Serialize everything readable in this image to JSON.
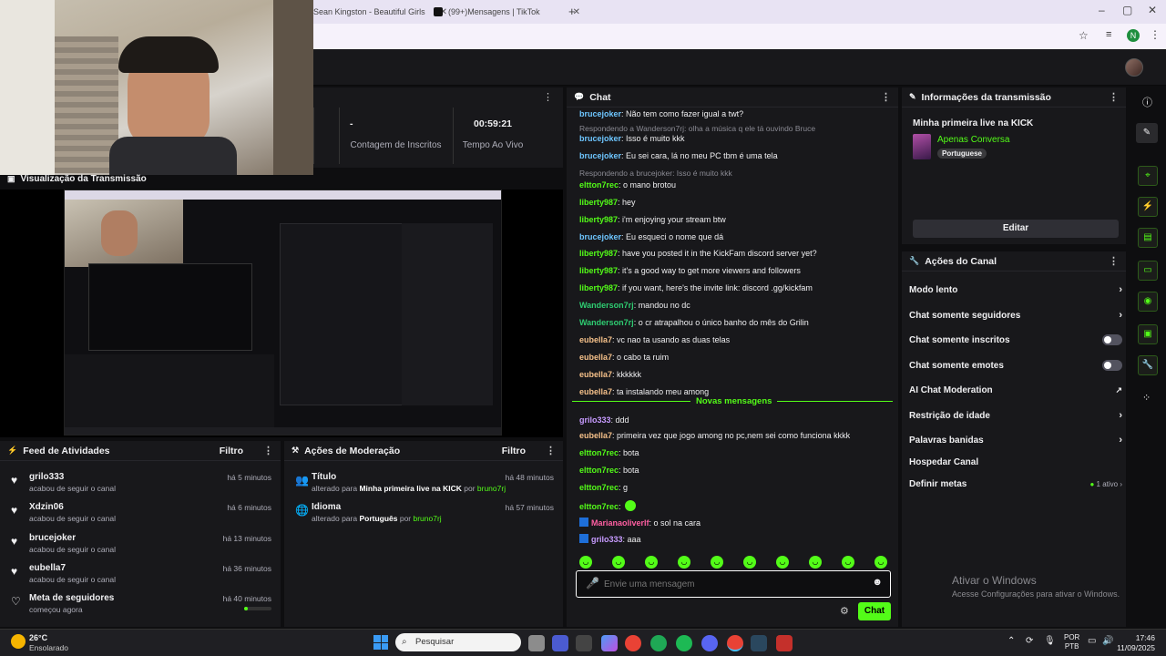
{
  "browser": {
    "tabs": [
      {
        "label": "Sean Kingston - Beautiful Girls"
      },
      {
        "label": "(99+)Mensagens | TikTok"
      }
    ],
    "new_tab": "+",
    "profile_initial": "N"
  },
  "stats": {
    "subs_value": "-",
    "subs_label": "Contagem de Inscritos",
    "time_value": "00:59:21",
    "time_label": "Tempo Ao Vivo"
  },
  "preview": {
    "title": "Visualização da Transmissão"
  },
  "activity": {
    "title": "Feed de Atividades",
    "filter": "Filtro",
    "items": [
      {
        "name": "grilo333",
        "desc": "acabou de seguir o canal",
        "time": "há 5 minutos"
      },
      {
        "name": "Xdzin06",
        "desc": "acabou de seguir o canal",
        "time": "há 6 minutos"
      },
      {
        "name": "brucejoker",
        "desc": "acabou de seguir o canal",
        "time": "há 13 minutos"
      },
      {
        "name": "eubella7",
        "desc": "acabou de seguir o canal",
        "time": "há 36 minutos"
      },
      {
        "name": "Meta de seguidores",
        "desc": "começou agora",
        "time": "há 40 minutos"
      }
    ]
  },
  "moderation": {
    "title": "Ações de Moderação",
    "filter": "Filtro",
    "items": [
      {
        "name": "Título",
        "pre": "alterado para ",
        "val": "Minha primeira live na KICK",
        "by": " por ",
        "user": "bruno7rj",
        "time": "há 48 minutos"
      },
      {
        "name": "Idioma",
        "pre": "alterado para ",
        "val": "Português",
        "by": " por ",
        "user": "bruno7rj",
        "time": "há 57 minutos"
      }
    ]
  },
  "chat": {
    "title": "Chat",
    "new_messages": "Novas mensagens",
    "placeholder": "Envie uma mensagem",
    "send": "Chat",
    "messages": [
      {
        "user": "brucejoker",
        "text": ": Não tem como fazer igual a twt?",
        "color": "#6ec6ff"
      },
      {
        "reply": "Respondendo a Wanderson7rj: olha a música q ele tá ouvindo Bruce"
      },
      {
        "user": "brucejoker",
        "text": ": Isso é muito kkk",
        "color": "#6ec6ff"
      },
      {
        "user": "brucejoker",
        "text": ": Eu sei cara, lá no meu PC tbm é uma tela",
        "color": "#6ec6ff"
      },
      {
        "reply": "Respondendo a brucejoker: Isso é muito kkk"
      },
      {
        "user": "eltton7rec",
        "text": ": o mano brotou",
        "color": "#53fc18"
      },
      {
        "user": "liberty987",
        "text": ": hey",
        "color": "#53fc18"
      },
      {
        "user": "liberty987",
        "text": ": i'm enjoying your stream btw",
        "color": "#53fc18"
      },
      {
        "user": "brucejoker",
        "text": ": Eu esqueci o nome que dá",
        "color": "#6ec6ff"
      },
      {
        "user": "liberty987",
        "text": ": have you posted it in the KickFam discord server yet?",
        "color": "#53fc18"
      },
      {
        "user": "liberty987",
        "text": ": it's a good way to get more viewers and followers",
        "color": "#53fc18"
      },
      {
        "user": "liberty987",
        "text": ": if you want, here's the invite link: discord .gg/kickfam",
        "color": "#53fc18"
      },
      {
        "user": "Wanderson7rj",
        "text": ": mandou no dc",
        "color": "#2ecc71"
      },
      {
        "user": "Wanderson7rj",
        "text": ": o cr atrapalhou o único banho do mês do Grilin",
        "color": "#2ecc71"
      },
      {
        "user": "eubella7",
        "text": ": vc nao ta usando as duas telas",
        "color": "#f5c089"
      },
      {
        "user": "eubella7",
        "text": ": o cabo ta ruim",
        "color": "#f5c089"
      },
      {
        "user": "eubella7",
        "text": ": kkkkkk",
        "color": "#f5c089"
      },
      {
        "user": "eubella7",
        "text": ": ta instalando meu among",
        "color": "#f5c089"
      }
    ],
    "new_list": [
      {
        "user": "grilo333",
        "text": ": ddd",
        "color": "#c79bff"
      },
      {
        "user": "eubella7",
        "text": ": primeira vez que jogo among no pc,nem sei como funciona kkkk",
        "color": "#f5c089"
      },
      {
        "user": "eltton7rec",
        "text": ": bota",
        "color": "#53fc18"
      },
      {
        "user": "eltton7rec",
        "text": ": bota",
        "color": "#53fc18"
      },
      {
        "user": "eltton7rec",
        "text": ": g",
        "color": "#53fc18"
      },
      {
        "user": "eltton7rec",
        "text": ":",
        "color": "#53fc18"
      },
      {
        "user": "Marianaoliverlf",
        "text": ": o sol na cara",
        "color": "#ff5fa2"
      },
      {
        "user": "grilo333",
        "text": ": aaa",
        "color": "#c79bff"
      }
    ]
  },
  "info": {
    "title": "Informações da transmissão",
    "stream_title": "Minha primeira live na KICK",
    "category": "Apenas Conversa",
    "language": "Portuguese",
    "edit": "Editar"
  },
  "actions": {
    "title": "Ações do Canal",
    "items": [
      {
        "label": "Modo lento",
        "kind": "chev"
      },
      {
        "label": "Chat somente seguidores",
        "kind": "chev"
      },
      {
        "label": "Chat somente inscritos",
        "kind": "toggle"
      },
      {
        "label": "Chat somente emotes",
        "kind": "toggle"
      },
      {
        "label": "AI Chat Moderation",
        "kind": "ext"
      },
      {
        "label": "Restrição de idade",
        "kind": "chev"
      },
      {
        "label": "Palavras banidas",
        "kind": "chev"
      },
      {
        "label": "Hospedar Canal",
        "kind": "none"
      },
      {
        "label": "Definir metas",
        "kind": "chev",
        "badge": "1 ativo"
      }
    ]
  },
  "windows": {
    "activate_title": "Ativar o Windows",
    "activate_sub": "Acesse Configurações para ativar o Windows."
  },
  "taskbar": {
    "temp": "26°C",
    "weather": "Ensolarado",
    "search": "Pesquisar",
    "lang1": "POR",
    "lang2": "PTB",
    "time": "17:46",
    "date": "11/09/2025"
  }
}
